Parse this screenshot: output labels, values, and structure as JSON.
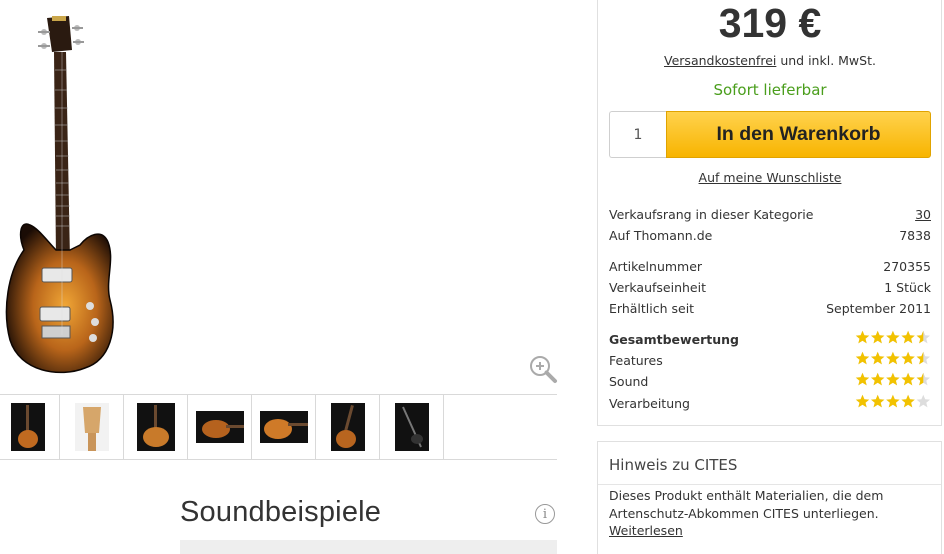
{
  "product": {
    "price": "319 €",
    "shipping_link": "Versandkostenfrei",
    "shipping_rest": " und inkl. MwSt.",
    "availability": "Sofort lieferbar",
    "quantity": "1",
    "cart_button": "In den Warenkorb",
    "wishlist_link": "Auf meine Wunschliste"
  },
  "ranking": [
    {
      "label": "Verkaufsrang in dieser Kategorie",
      "value": "30",
      "link": true
    },
    {
      "label": "Auf Thomann.de",
      "value": "7838",
      "link": false
    }
  ],
  "details": [
    {
      "label": "Artikelnummer",
      "value": "270355"
    },
    {
      "label": "Verkaufseinheit",
      "value": "1 Stück"
    },
    {
      "label": "Erhältlich seit",
      "value": "September 2011"
    }
  ],
  "ratings": {
    "colors": {
      "filled": "#f2c200",
      "empty": "#dddddd"
    },
    "items": [
      {
        "label": "Gesamtbewertung",
        "stars": 4.5
      },
      {
        "label": "Features",
        "stars": 4.5
      },
      {
        "label": "Sound",
        "stars": 4.5
      },
      {
        "label": "Verarbeitung",
        "stars": 4.0
      }
    ]
  },
  "cites": {
    "title": "Hinweis zu CITES",
    "text": "Dieses Produkt enthält Materialien, die dem Artenschutz-Abkommen CITES unterliegen.",
    "link": "Weiterlesen"
  },
  "gallery": {
    "thumbnail_count": 7,
    "zoom_icon": "zoom-in-icon"
  },
  "sound": {
    "title": "Soundbeispiele",
    "info_icon": "i"
  },
  "colors": {
    "accent": "#f8b400",
    "available": "#4a9e1c"
  }
}
